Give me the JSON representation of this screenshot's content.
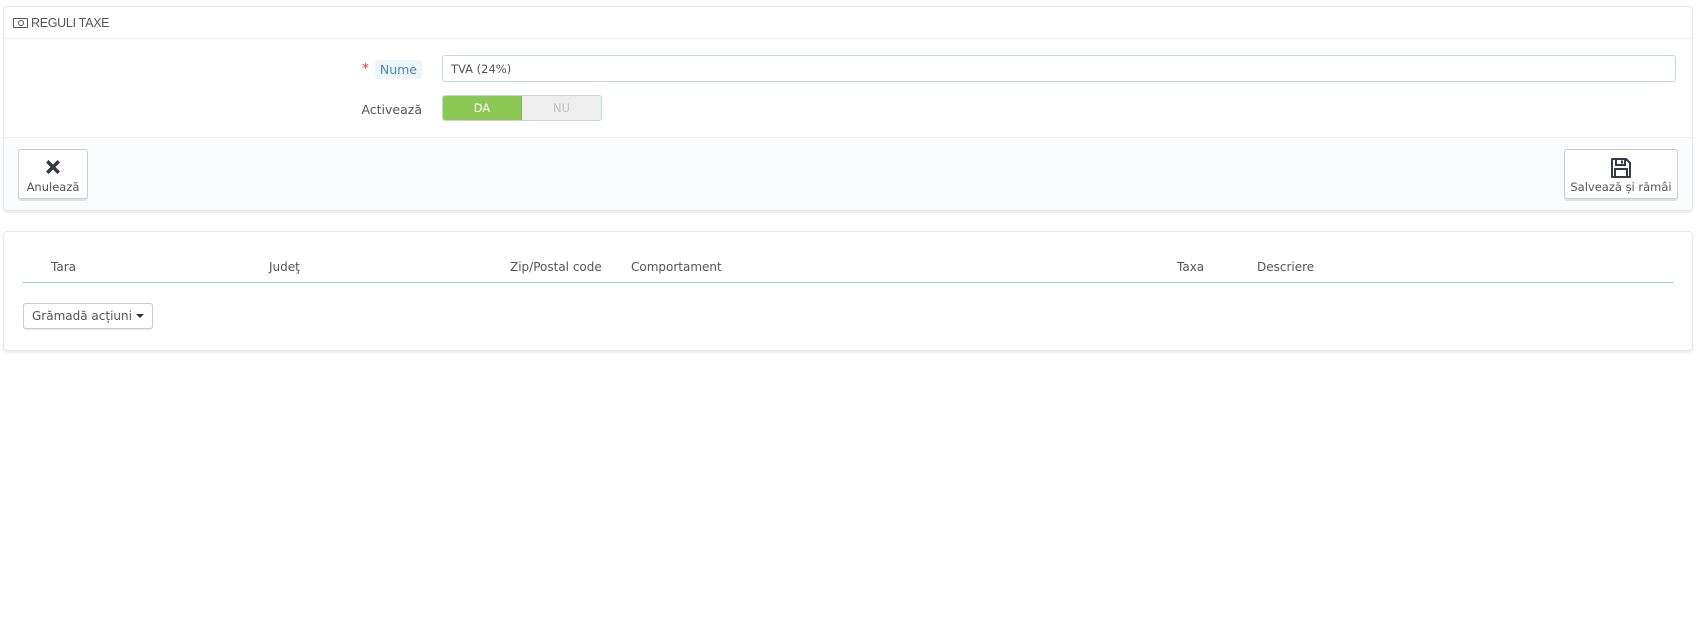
{
  "panel_form": {
    "title": "REGULI TAXE",
    "title_icon": "money-icon",
    "fields": {
      "name": {
        "required_mark": "*",
        "label": "Nume",
        "value": "TVA (24%)"
      },
      "enable": {
        "label": "Activează",
        "options": [
          "DA",
          "NU"
        ],
        "selected": "DA"
      }
    },
    "footer": {
      "cancel_label": "Anulează",
      "cancel_icon": "close-icon",
      "save_label": "Salvează și rămâi",
      "save_icon": "floppy-disk-icon"
    }
  },
  "panel_list": {
    "columns": [
      "Tara",
      "Judeţ",
      "Zip/Postal code",
      "Comportament",
      "Taxa",
      "Descriere"
    ],
    "rows": [],
    "bulk_actions_label": "Grămadă acțiuni"
  },
  "colors": {
    "switch_active": "#8bc954",
    "switch_inactive": "#eeeeee",
    "required_star": "#e23e25",
    "label_highlight_bg": "#eef4f8",
    "label_highlight_text": "#4a8ab4",
    "table_header_border": "#a0c7e4"
  }
}
